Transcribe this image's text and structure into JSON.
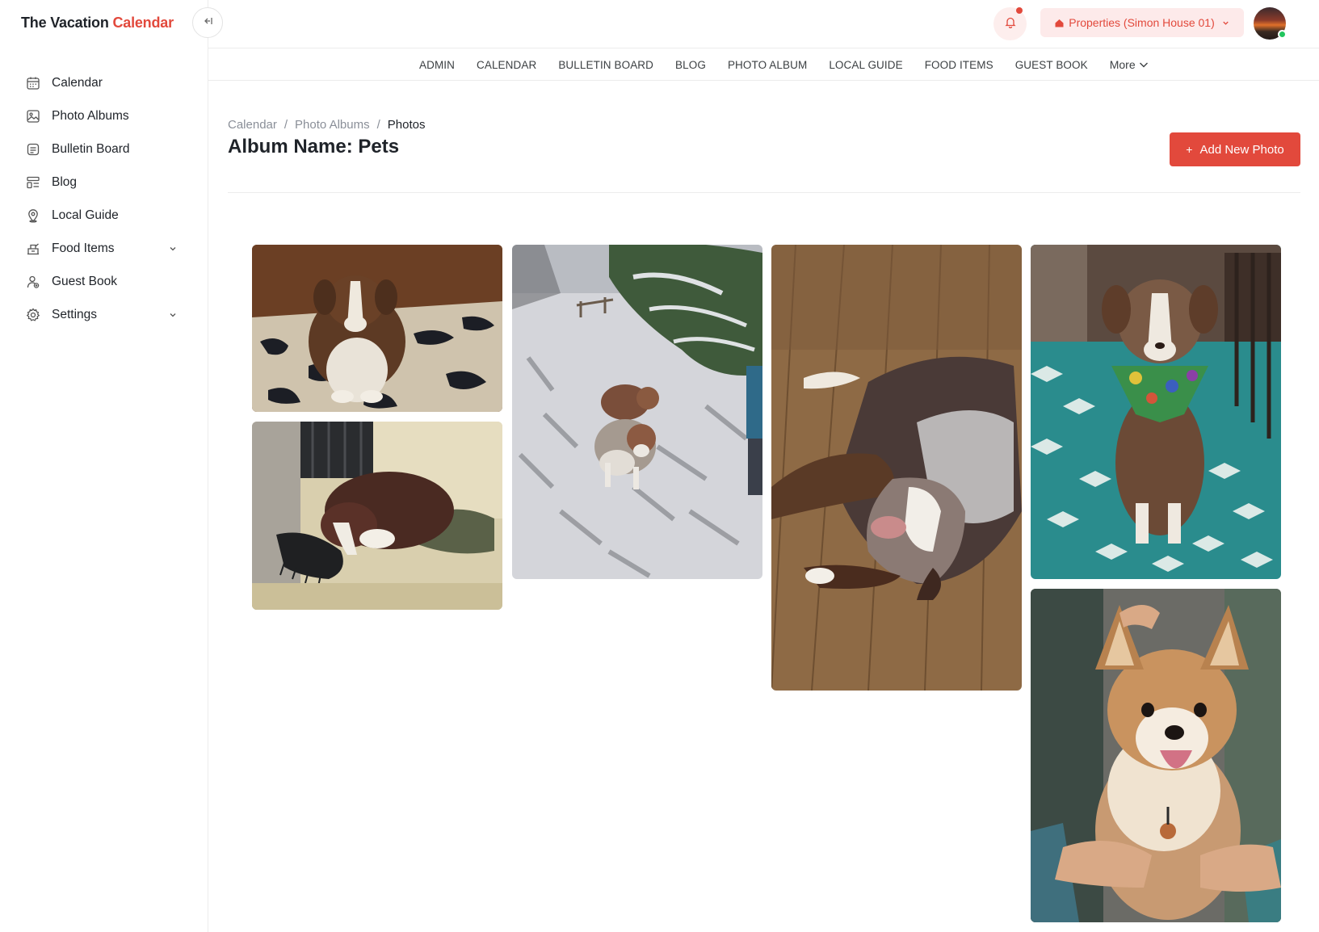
{
  "brand": {
    "part1": "The Vacation",
    "part2": "Calendar"
  },
  "sidebar": {
    "items": [
      {
        "label": "Calendar",
        "icon": "calendar-icon"
      },
      {
        "label": "Photo Albums",
        "icon": "image-icon"
      },
      {
        "label": "Bulletin Board",
        "icon": "board-icon"
      },
      {
        "label": "Blog",
        "icon": "blog-icon"
      },
      {
        "label": "Local Guide",
        "icon": "map-pin-icon"
      },
      {
        "label": "Food Items",
        "icon": "food-icon",
        "expandable": true
      },
      {
        "label": "Guest Book",
        "icon": "guest-icon"
      },
      {
        "label": "Settings",
        "icon": "gear-icon",
        "expandable": true
      }
    ]
  },
  "header": {
    "properties_label": "Properties (Simon House 01)",
    "notification_dot": true
  },
  "menu": {
    "items": [
      "ADMIN",
      "CALENDAR",
      "BULLETIN BOARD",
      "BLOG",
      "PHOTO ALBUM",
      "LOCAL GUIDE",
      "FOOD ITEMS",
      "GUEST BOOK"
    ],
    "more_label": "More"
  },
  "breadcrumb": {
    "items": [
      "Calendar",
      "Photo Albums"
    ],
    "current": "Photos"
  },
  "page": {
    "title": "Album Name: Pets",
    "add_button_label": "Add New Photo"
  },
  "colors": {
    "accent": "#e2493c",
    "accent_soft": "#fdeaea",
    "online": "#22c55e"
  },
  "photos": [
    {
      "subject": "brown and white puppy on leopard rug"
    },
    {
      "subject": "dog sleeping on sheepskin couch"
    },
    {
      "subject": "two dogs walking on snowy path"
    },
    {
      "subject": "dog lying on wooden floor"
    },
    {
      "subject": "puppy with tie-dye bandana on teal rug"
    },
    {
      "subject": "corgi puppy being held"
    }
  ]
}
